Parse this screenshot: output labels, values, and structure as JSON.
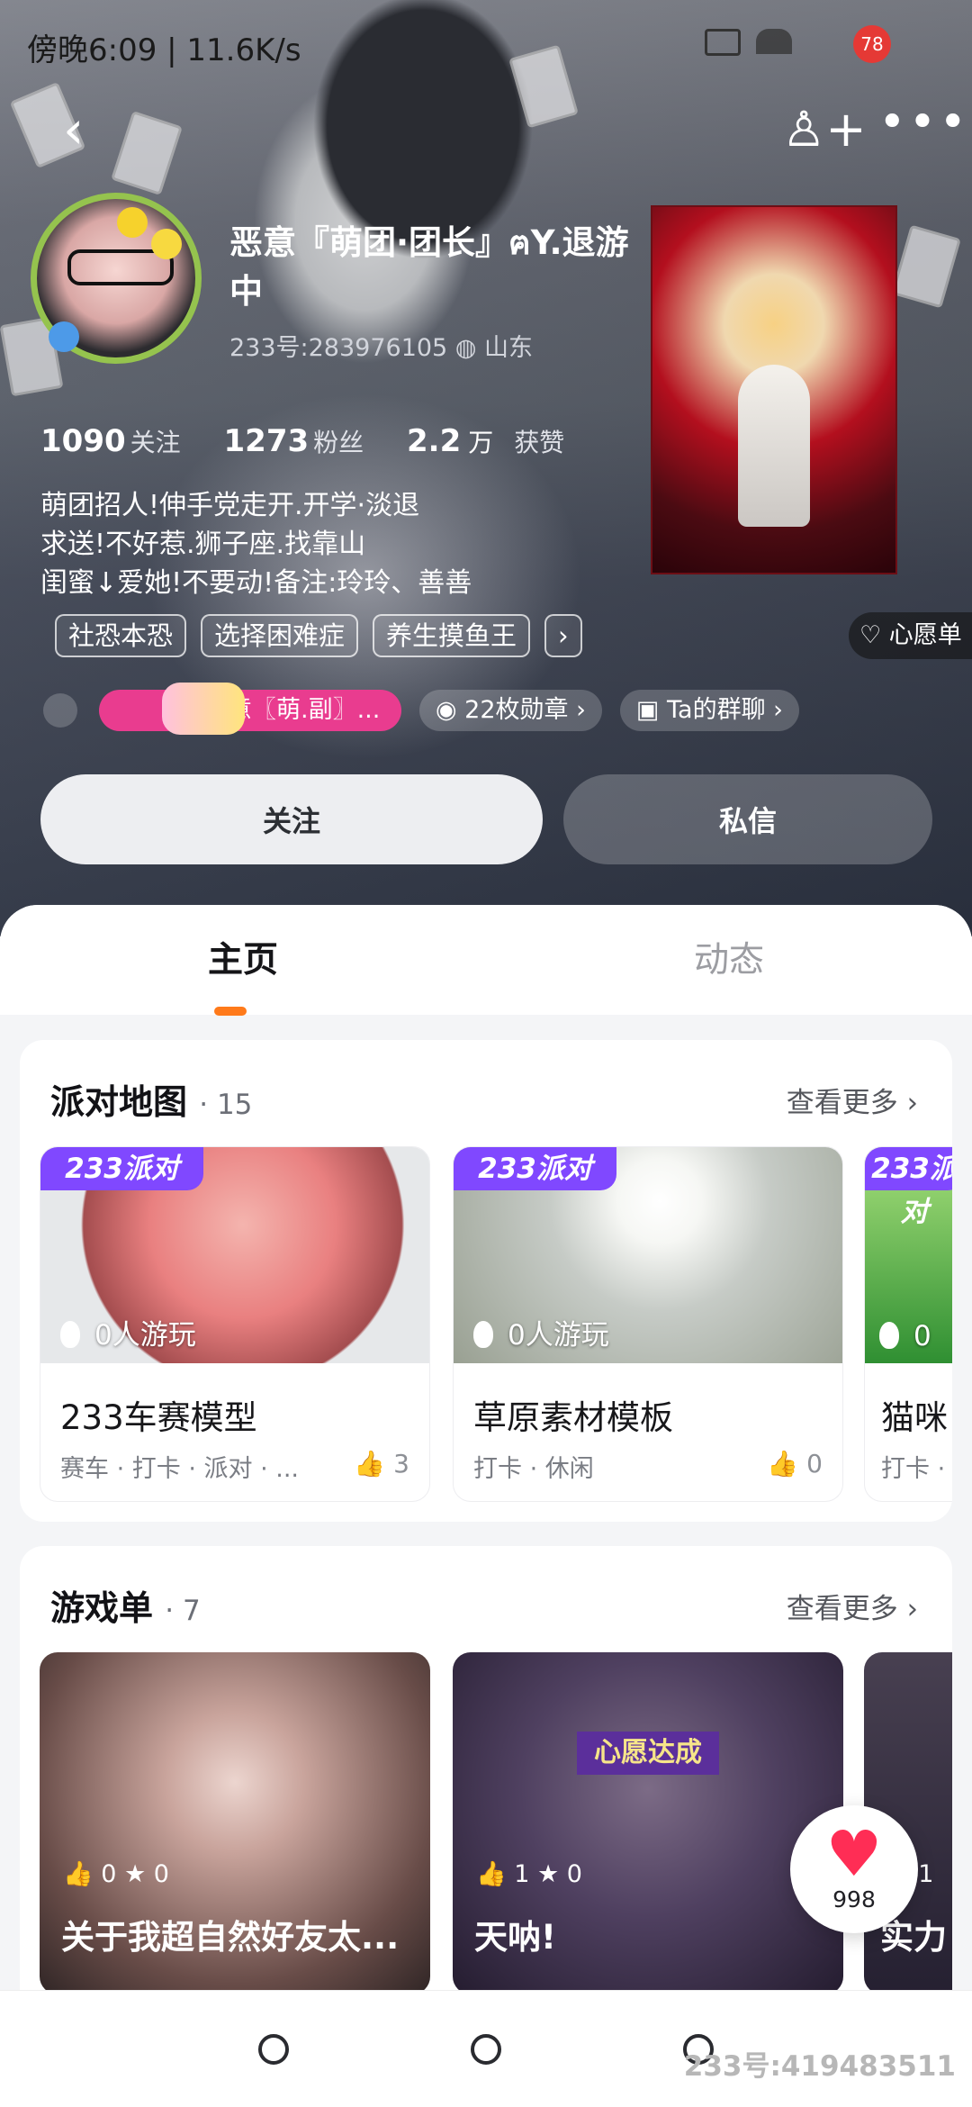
{
  "status_bar": {
    "time": "傍晚6:09 | 11.6K/s",
    "battery": "78"
  },
  "profile": {
    "name": "恶意『萌团·团长』ฅY.退游中",
    "account": "233号:283976105",
    "location": "山东",
    "stats": [
      {
        "value": "1090",
        "label": "关注"
      },
      {
        "value": "1273",
        "label": "粉丝"
      },
      {
        "value": "2.2",
        "unit": "万",
        "label": "获赞"
      }
    ],
    "bio": [
      "萌团招人!伸手党走开.开学·淡退",
      "求送!不好惹.狮子座.找靠山",
      "闺蜜↓爱她!不要动!备注:玲玲、善善"
    ],
    "tags": [
      "社恐本恐",
      "选择困难症",
      "养生摸鱼王"
    ],
    "wish_label": "心愿单",
    "badges": [
      "善意〖萌.副〗...",
      "22枚勋章",
      "Ta的群聊"
    ],
    "buttons": {
      "follow": "关注",
      "message": "私信"
    }
  },
  "tabs": {
    "home": "主页",
    "feed": "动态"
  },
  "party_map": {
    "title": "派对地图",
    "count": "· 15",
    "more": "查看更多",
    "badge": "233派对",
    "cards": [
      {
        "title": "233车赛模型",
        "plays": "0人游玩",
        "tags": "赛车 · 打卡 · 派对 · ...",
        "likes": "3"
      },
      {
        "title": "草原素材模板",
        "plays": "0人游玩",
        "tags": "打卡 · 休闲",
        "likes": "0"
      },
      {
        "title": "猫咪",
        "plays": "0",
        "tags": "打卡 · ",
        "likes": ""
      }
    ]
  },
  "game_list": {
    "title": "游戏单",
    "count": "· 7",
    "more": "查看更多",
    "cards": [
      {
        "title": "关于我超自然好友太...",
        "likes": "0",
        "stars": "0"
      },
      {
        "title": "天呐!",
        "likes": "1",
        "stars": "0",
        "overlay": "心愿达成"
      },
      {
        "title": "实力",
        "likes": "1",
        "stars": ""
      }
    ]
  },
  "floating_like": {
    "count": "998"
  },
  "watermark": "233号:419483511"
}
